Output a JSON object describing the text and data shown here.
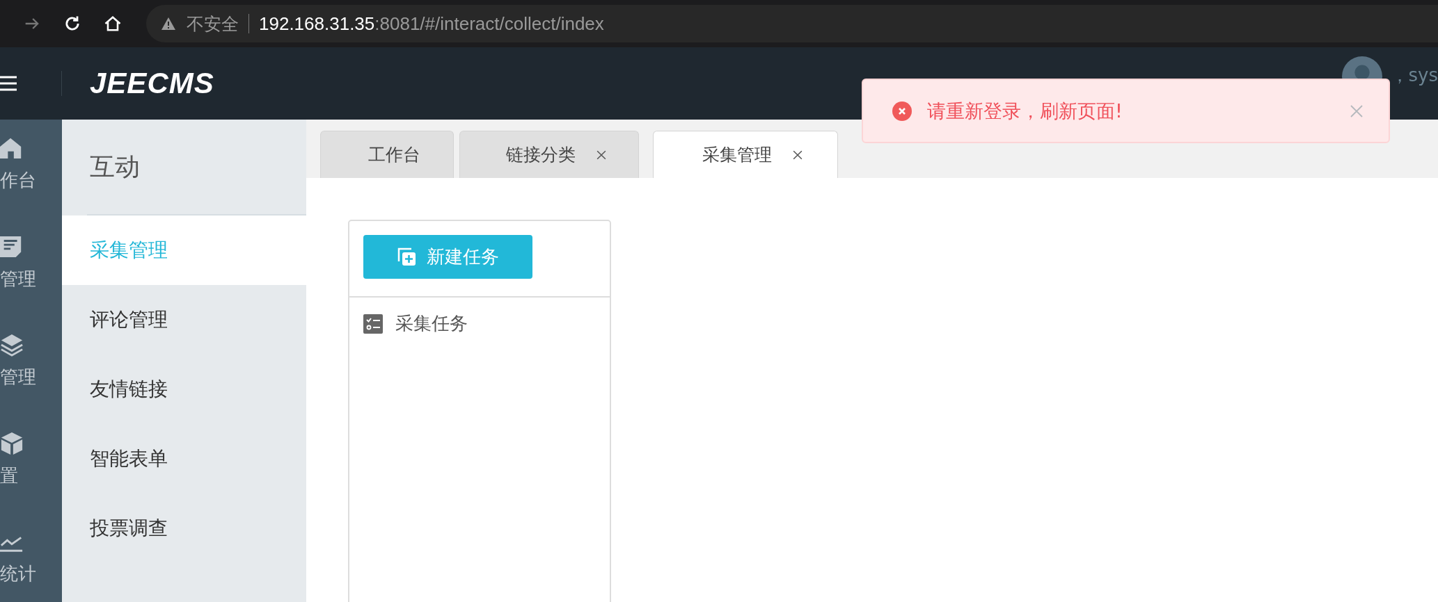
{
  "browser": {
    "security_label": "不安全",
    "url_host": "192.168.31.35",
    "url_rest": ":8081/#/interact/collect/index"
  },
  "header": {
    "logo": "JEECMS",
    "user_greeting": "，sys"
  },
  "rail": [
    {
      "kind": "home",
      "label": "作台"
    },
    {
      "kind": "doc",
      "label": "管理"
    },
    {
      "kind": "layers",
      "label": "管理"
    },
    {
      "kind": "box",
      "label": "置"
    },
    {
      "kind": "chart",
      "label": "统计"
    }
  ],
  "submenu": {
    "title": "互动",
    "items": [
      {
        "label": "采集管理",
        "selected": true
      },
      {
        "label": "评论管理",
        "selected": false
      },
      {
        "label": "友情链接",
        "selected": false
      },
      {
        "label": "智能表单",
        "selected": false
      },
      {
        "label": "投票调查",
        "selected": false
      }
    ]
  },
  "tabs": [
    {
      "label": "工作台",
      "closable": false,
      "selected": false
    },
    {
      "label": "链接分类",
      "closable": true,
      "selected": false
    },
    {
      "label": "采集管理",
      "closable": true,
      "selected": true
    }
  ],
  "panel": {
    "button": "新建任务",
    "items": [
      "采集任务"
    ]
  },
  "toast": {
    "kind": "error",
    "message": "请重新登录，刷新页面!"
  }
}
